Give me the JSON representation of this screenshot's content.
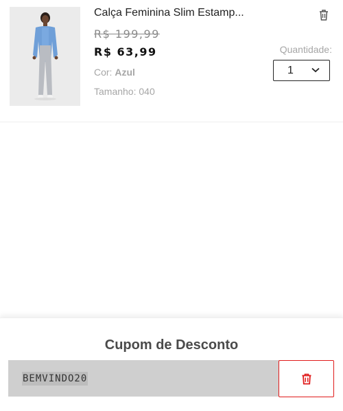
{
  "cart": {
    "item": {
      "title": "Calça Feminina Slim Estamp...",
      "old_price": "R$ 199,99",
      "new_price": "R$ 63,99",
      "color_label": "Cor: ",
      "color_value": "Azul",
      "size_label": "Tamanho: ",
      "size_value": "040",
      "quantity_label": "Quantidade:",
      "quantity_value": "1",
      "image_icon": "product-photo",
      "remove_icon": "trash-icon"
    }
  },
  "coupon": {
    "title": "Cupom de Desconto",
    "code": "BEMVINDO20",
    "remove_icon": "trash-icon",
    "accent_color": "#e01a1a"
  }
}
